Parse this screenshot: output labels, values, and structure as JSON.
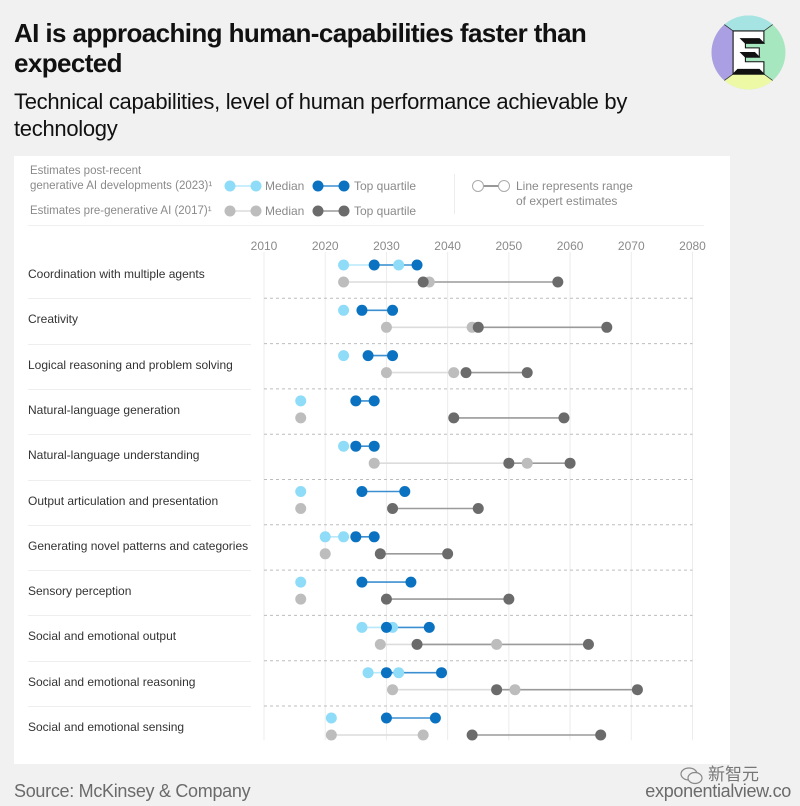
{
  "header": {
    "title": "AI is approaching human-capabilities faster than expected",
    "subtitle": "Technical capabilities, level of human performance achievable by technology",
    "logo_icon": "exponential-view-e-logo"
  },
  "legend": {
    "post_label_line1": "Estimates post-recent",
    "post_label_line2": "generative AI developments (2023)¹",
    "pre_label": "Estimates pre-generative AI (2017)¹",
    "median_label": "Median",
    "top_quartile_label": "Top quartile",
    "range_note_line1": "Line represents range",
    "range_note_line2": "of expert estimates"
  },
  "colors": {
    "post_median": "#8fdcf8",
    "post_top": "#0a72c0",
    "pre_median": "#bdbdbd",
    "pre_top": "#6b6b6b",
    "post_median_line": "#b9e8fa",
    "post_top_line": "#3b8fd0",
    "pre_median_line": "#dcdcdc",
    "pre_top_line": "#9a9a9a"
  },
  "chart_data": {
    "type": "scatter",
    "subtype": "dumbbell",
    "title": "AI is approaching human-capabilities faster than expected",
    "subtitle": "Technical capabilities, level of human performance achievable by technology",
    "xlabel": "",
    "ylabel": "",
    "x_ticks": [
      "2010",
      "2020",
      "2030",
      "2040",
      "2050",
      "2060",
      "2070",
      "2080"
    ],
    "xlim": [
      2010,
      2080
    ],
    "grid": true,
    "legend_position": "top",
    "series_names": {
      "post_median": "Estimates post-recent generative AI developments (2023) – Median",
      "post_top": "Estimates post-recent generative AI developments (2023) – Top quartile",
      "pre_median": "Estimates pre-generative AI (2017) – Median",
      "pre_top": "Estimates pre-generative AI (2017) – Top quartile"
    },
    "categories": [
      "Coordination with multiple agents",
      "Creativity",
      "Logical reasoning and problem solving",
      "Natural-language generation",
      "Natural-language understanding",
      "Output articulation and presentation",
      "Generating novel patterns and categories",
      "Sensory perception",
      "Social and emotional output",
      "Social and emotional reasoning",
      "Social and emotional sensing"
    ],
    "rows": [
      {
        "post_median": [
          2023,
          2032
        ],
        "post_top": [
          2028,
          2035
        ],
        "pre_median": [
          2023,
          2037
        ],
        "pre_top": [
          2036,
          2058
        ]
      },
      {
        "post_median": [
          2023,
          2023
        ],
        "post_top": [
          2026,
          2031
        ],
        "pre_median": [
          2030,
          2044
        ],
        "pre_top": [
          2045,
          2066
        ]
      },
      {
        "post_median": [
          2023,
          2023
        ],
        "post_top": [
          2027,
          2031
        ],
        "pre_median": [
          2030,
          2041
        ],
        "pre_top": [
          2043,
          2053
        ]
      },
      {
        "post_median": [
          2016,
          2016
        ],
        "post_top": [
          2025,
          2028
        ],
        "pre_median": [
          2016,
          2016
        ],
        "pre_top": [
          2041,
          2059
        ]
      },
      {
        "post_median": [
          2023,
          2023
        ],
        "post_top": [
          2025,
          2028
        ],
        "pre_median": [
          2028,
          2053
        ],
        "pre_top": [
          2050,
          2060
        ]
      },
      {
        "post_median": [
          2016,
          2016
        ],
        "post_top": [
          2026,
          2033
        ],
        "pre_median": [
          2016,
          2016
        ],
        "pre_top": [
          2031,
          2045
        ]
      },
      {
        "post_median": [
          2020,
          2023
        ],
        "post_top": [
          2025,
          2028
        ],
        "pre_median": [
          2020,
          2020
        ],
        "pre_top": [
          2029,
          2040
        ]
      },
      {
        "post_median": [
          2016,
          2016
        ],
        "post_top": [
          2026,
          2034
        ],
        "pre_median": [
          2016,
          2016
        ],
        "pre_top": [
          2030,
          2050
        ]
      },
      {
        "post_median": [
          2026,
          2031
        ],
        "post_top": [
          2030,
          2037
        ],
        "pre_median": [
          2029,
          2048
        ],
        "pre_top": [
          2035,
          2063
        ]
      },
      {
        "post_median": [
          2027,
          2032
        ],
        "post_top": [
          2030,
          2039
        ],
        "pre_median": [
          2031,
          2051
        ],
        "pre_top": [
          2048,
          2071
        ]
      },
      {
        "post_median": [
          2021,
          2021
        ],
        "post_top": [
          2030,
          2038
        ],
        "pre_median": [
          2021,
          2036
        ],
        "pre_top": [
          2044,
          2065
        ]
      }
    ]
  },
  "footer": {
    "source": "Source: McKinsey & Company",
    "site": "exponentialview.co",
    "watermark": "新智元"
  }
}
